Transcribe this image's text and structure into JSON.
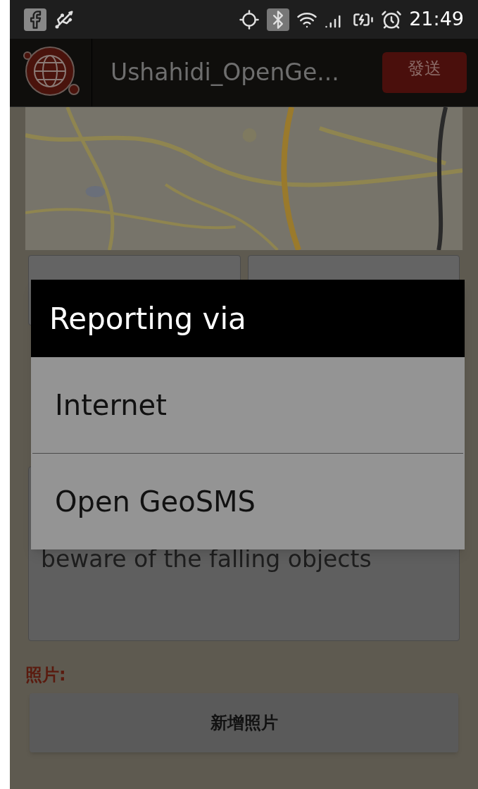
{
  "status_bar": {
    "time": "21:49"
  },
  "app_bar": {
    "title": "Ushahidi_OpenGe...",
    "send_button": "發送"
  },
  "description": {
    "value": "beware of the falling objects"
  },
  "photo_section": {
    "label": "照片:",
    "add_button": "新增照片"
  },
  "dialog": {
    "title": "Reporting via",
    "options": [
      {
        "label": "Internet"
      },
      {
        "label": "Open GeoSMS"
      }
    ]
  }
}
